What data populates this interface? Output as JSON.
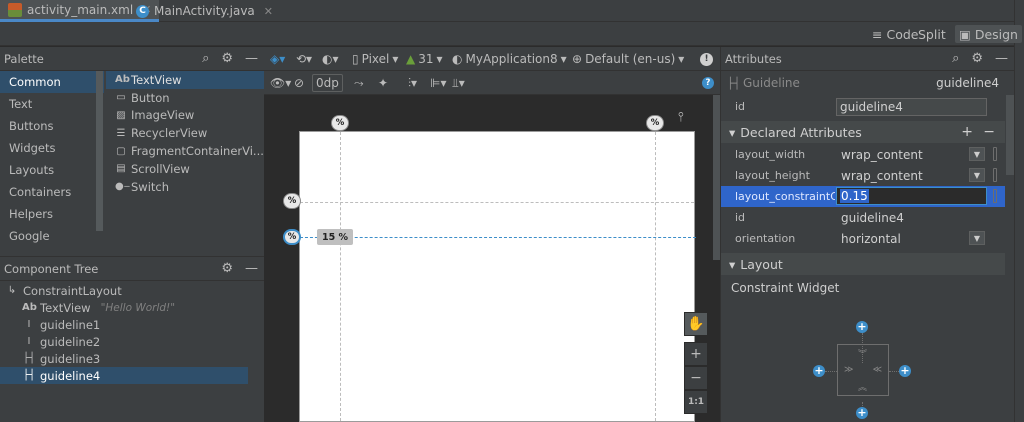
{
  "tabs": [
    {
      "label": "activity_main.xml",
      "active": true,
      "icon": "xml-layout-icon"
    },
    {
      "label": "MainActivity.java",
      "active": false,
      "icon": "java-class-icon"
    }
  ],
  "view_modes": {
    "code": "Code",
    "split": "Split",
    "design": "Design",
    "selected": "Design"
  },
  "palette": {
    "title": "Palette",
    "categories": [
      "Common",
      "Text",
      "Buttons",
      "Widgets",
      "Layouts",
      "Containers",
      "Helpers",
      "Google"
    ],
    "selected_category": "Common",
    "widgets": [
      {
        "label": "TextView",
        "icon": "textview-icon"
      },
      {
        "label": "Button",
        "icon": "button-icon"
      },
      {
        "label": "ImageView",
        "icon": "image-icon"
      },
      {
        "label": "RecyclerView",
        "icon": "list-icon"
      },
      {
        "label": "FragmentContainerVi...",
        "icon": "fragment-icon"
      },
      {
        "label": "ScrollView",
        "icon": "scroll-icon"
      },
      {
        "label": "Switch",
        "icon": "switch-icon"
      }
    ]
  },
  "component_tree": {
    "title": "Component Tree",
    "nodes": [
      {
        "label": "ConstraintLayout",
        "icon": "constraint-layout-icon",
        "hint": ""
      },
      {
        "label": "TextView",
        "icon": "textview-icon",
        "hint": "\"Hello World!\""
      },
      {
        "label": "guideline1",
        "icon": "vertical-guideline-icon",
        "hint": ""
      },
      {
        "label": "guideline2",
        "icon": "vertical-guideline-icon",
        "hint": ""
      },
      {
        "label": "guideline3",
        "icon": "horizontal-guideline-icon",
        "hint": ""
      },
      {
        "label": "guideline4",
        "icon": "horizontal-guideline-icon",
        "hint": ""
      }
    ],
    "selected": "guideline4"
  },
  "design_toolbar": {
    "device": "Pixel",
    "api": "31",
    "theme": "MyApplication8",
    "locale": "Default (en-us)",
    "default_margin": "0dp"
  },
  "canvas": {
    "guide_badge": "%",
    "selected_guide_label": "15 %",
    "zoom_reset": "1:1"
  },
  "attributes": {
    "title": "Attributes",
    "element_type": "Guideline",
    "element_id": "guideline4",
    "id_label": "id",
    "id_value": "guideline4",
    "declared_title": "Declared Attributes",
    "rows": [
      {
        "key": "layout_width",
        "value": "wrap_content",
        "dropdown": true
      },
      {
        "key": "layout_height",
        "value": "wrap_content",
        "dropdown": true
      },
      {
        "key": "layout_constraintGui...",
        "value": "0.15",
        "dropdown": false,
        "selected": true
      },
      {
        "key": "id",
        "value": "guideline4",
        "dropdown": false
      },
      {
        "key": "orientation",
        "value": "horizontal",
        "dropdown": true
      }
    ],
    "layout_title": "Layout",
    "constraint_widget_title": "Constraint Widget"
  },
  "colors": {
    "accent": "#3d8ec9",
    "selection": "#2f4f6b",
    "panel": "#3c3f41",
    "background": "#2b2b2b"
  }
}
